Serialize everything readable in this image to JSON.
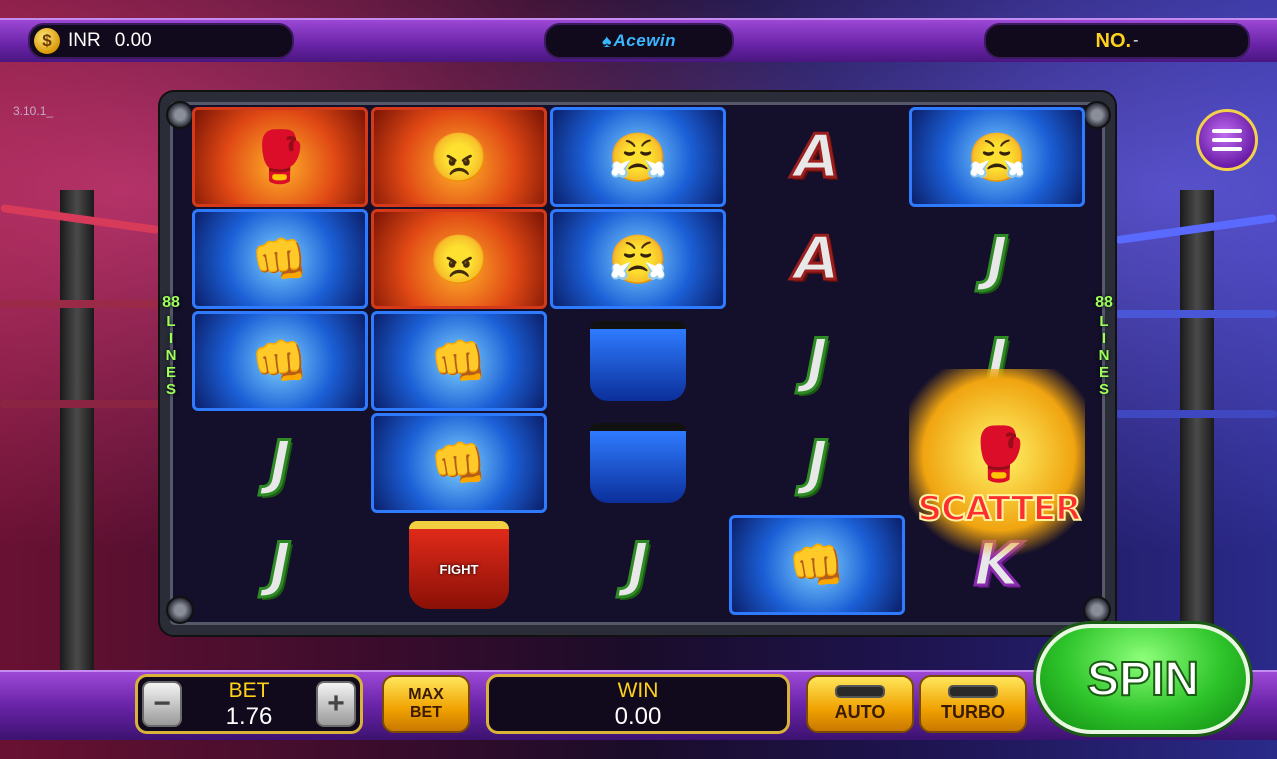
{
  "top_bar": {
    "currency_icon": "coin-icon",
    "coin_glyph": "$",
    "currency": "INR",
    "balance": "0.00",
    "logo": "Acewin",
    "no_label": "NO.",
    "no_value": "-"
  },
  "version": "3.10.1_",
  "lines": {
    "left_count": "88",
    "left_text": "LINES",
    "right_count": "88",
    "right_text": "LINES"
  },
  "reels": {
    "col1": [
      "flaming-glove",
      "blue-fist",
      "blue-fist",
      "J",
      "J"
    ],
    "col2": [
      "red-fighter",
      "red-fighter",
      "blue-fist",
      "blue-fist",
      "red-shorts"
    ],
    "col3": [
      "blue-fighter",
      "blue-fighter",
      "blue-shorts",
      "blue-shorts",
      "J"
    ],
    "col4": [
      "A",
      "A",
      "J",
      "J",
      "blue-fist"
    ],
    "col5": [
      "blue-fighter",
      "J",
      "J",
      "scatter",
      "K"
    ],
    "letters": {
      "c1r4": "J",
      "c1r5": "J",
      "c3r5": "J",
      "c4r1": "A",
      "c4r2": "A",
      "c4r3": "J",
      "c4r4": "J",
      "c5r2": "J",
      "c5r3": "J",
      "c5r5": "K"
    },
    "shorts_text": "FIGHT",
    "scatter_label": "SCATTER"
  },
  "bottom_bar": {
    "bet_label": "BET",
    "bet_value": "1.76",
    "minus": "−",
    "plus": "+",
    "max_bet_line1": "MAX",
    "max_bet_line2": "BET",
    "win_label": "WIN",
    "win_value": "0.00",
    "auto_label": "AUTO",
    "turbo_label": "TURBO",
    "spin_label": "SPIN"
  },
  "colors": {
    "accent_purple": "#7a2bbd",
    "gold": "#ffd21a",
    "spin_green": "#2ec42a"
  }
}
